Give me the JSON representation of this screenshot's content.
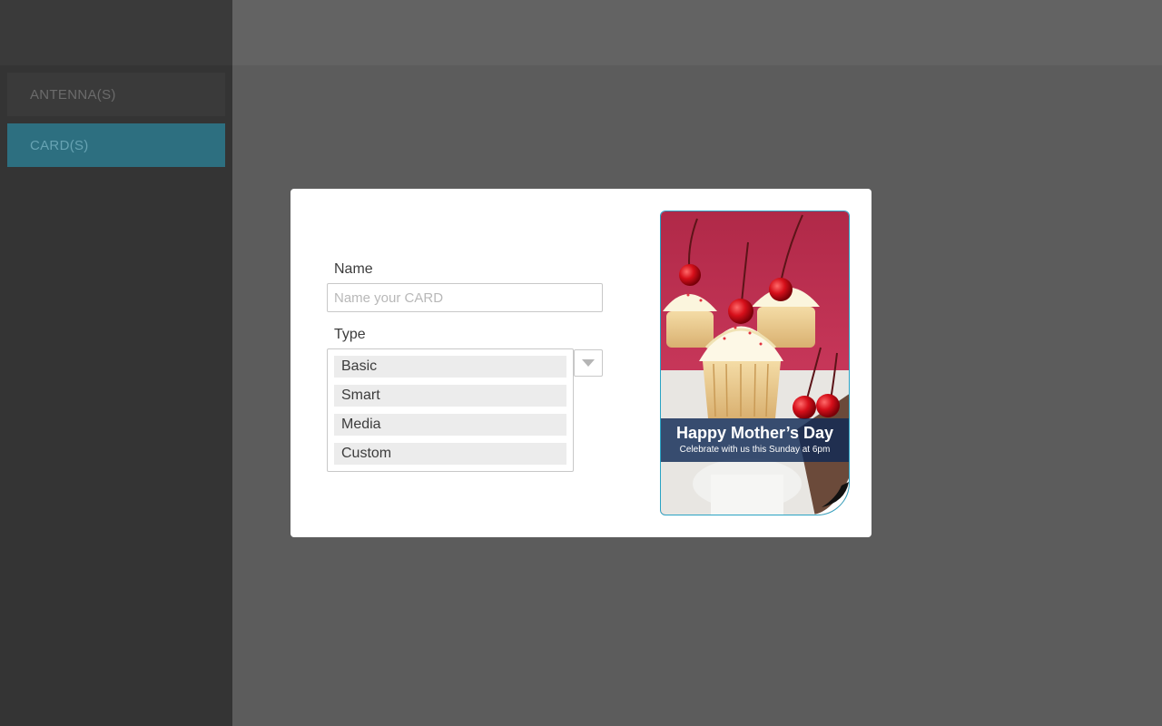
{
  "sidebar": {
    "items": [
      {
        "label": "ANTENNA(S)",
        "active": false
      },
      {
        "label": "CARD(S)",
        "active": true
      }
    ]
  },
  "modal": {
    "name_label": "Name",
    "name_value": "",
    "name_placeholder": "Name your CARD",
    "type_label": "Type",
    "type_options": [
      "Basic",
      "Smart",
      "Media",
      "Custom"
    ],
    "type_dropdown_icon": "caret-down-icon",
    "card_preview": {
      "title": "Happy Mother’s Day",
      "subtitle": "Celebrate with us this Sunday at 6pm",
      "image": "cupcakes-with-cherries"
    }
  },
  "colors": {
    "accent": "#2aa3c4",
    "active_nav": "#2d6f80",
    "overlay_dim": "#5c5c5c",
    "banner": "#102a56"
  }
}
